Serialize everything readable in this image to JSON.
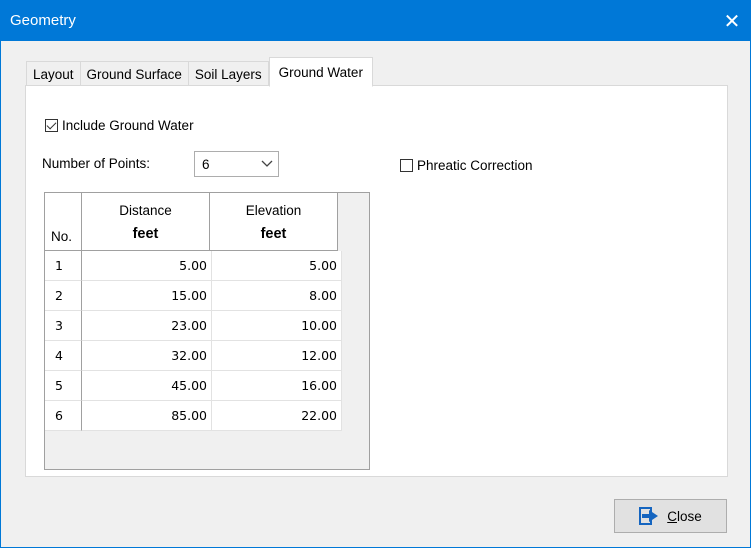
{
  "window": {
    "title": "Geometry",
    "close_glyph": "✕"
  },
  "tabs": [
    {
      "label": "Layout"
    },
    {
      "label": "Ground Surface"
    },
    {
      "label": "Soil Layers"
    },
    {
      "label": "Ground Water",
      "active": true
    }
  ],
  "include_ground_water": {
    "label": "Include Ground Water",
    "checked": true
  },
  "phreatic_correction": {
    "label": "Phreatic Correction",
    "checked": false
  },
  "number_of_points": {
    "label": "Number of Points:",
    "value": "6"
  },
  "table": {
    "headers": {
      "no": "No.",
      "distance": "Distance",
      "distance_unit": "feet",
      "elevation": "Elevation",
      "elevation_unit": "feet"
    },
    "rows": [
      {
        "no": "1",
        "distance": "5.00",
        "elevation": "5.00"
      },
      {
        "no": "2",
        "distance": "15.00",
        "elevation": "8.00"
      },
      {
        "no": "3",
        "distance": "23.00",
        "elevation": "10.00"
      },
      {
        "no": "4",
        "distance": "32.00",
        "elevation": "12.00"
      },
      {
        "no": "5",
        "distance": "45.00",
        "elevation": "16.00"
      },
      {
        "no": "6",
        "distance": "85.00",
        "elevation": "22.00"
      }
    ]
  },
  "close_button": {
    "mnemonic": "C",
    "rest": "lose"
  },
  "colors": {
    "titlebar": "#0078d7",
    "dialog_bg": "#f0f0f0",
    "close_icon": "#1565c0"
  },
  "icons": {
    "close_button": "exit-door-icon",
    "dropdown": "chevron-down-icon",
    "window_close": "close-icon"
  }
}
